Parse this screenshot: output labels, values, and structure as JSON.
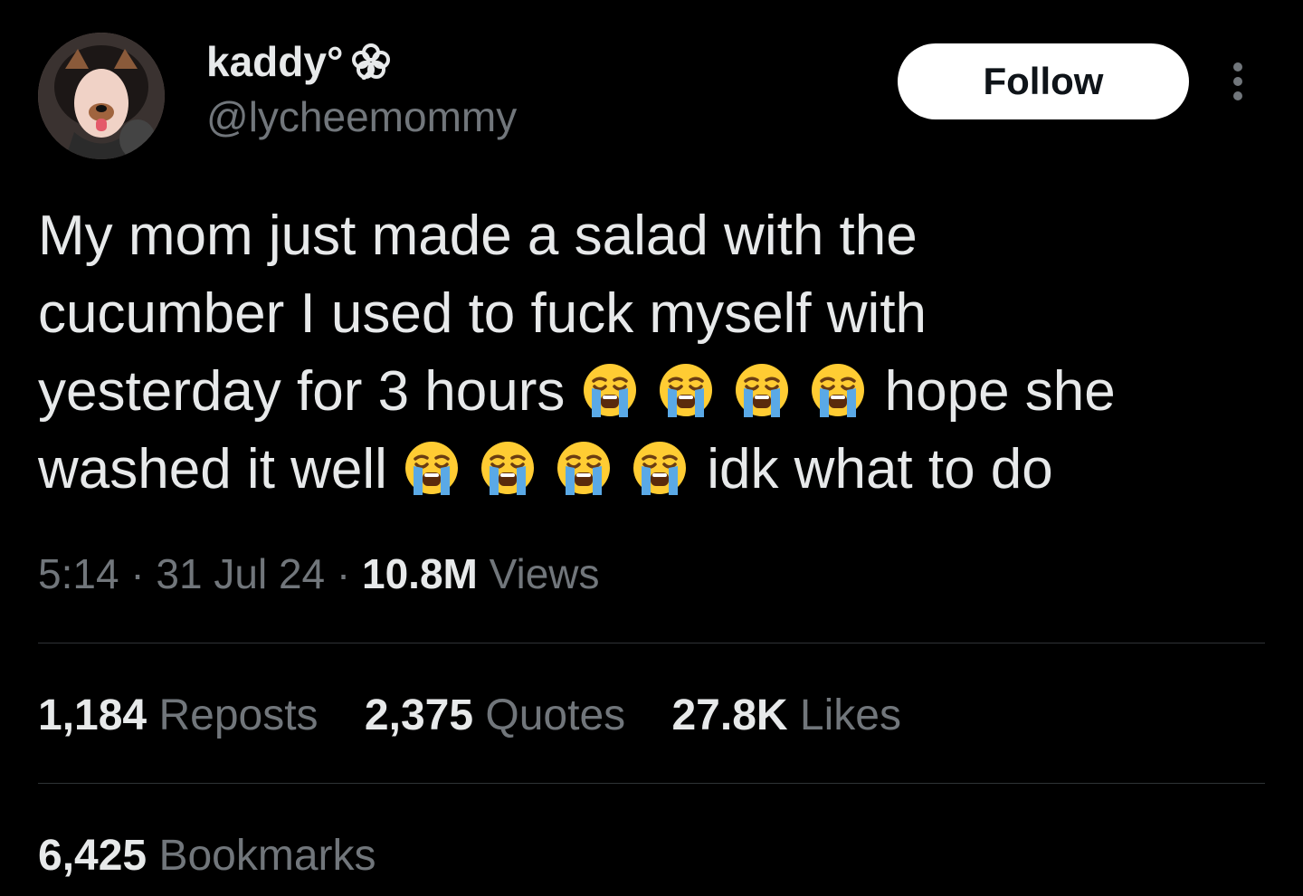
{
  "author": {
    "display_name": "kaddy°",
    "handle": "@lycheemommy",
    "avatar_icon": "avatar-photo",
    "name_decoration_icon": "flower-icon"
  },
  "follow_label": "Follow",
  "more_icon": "more-vertical-icon",
  "tweet": {
    "line1": "My mom just made a salad with the",
    "line2": "cucumber I used to fuck myself with",
    "line3_text": "yesterday for 3 hours",
    "line3_tail": "hope she",
    "line4_text": "washed it well",
    "line4_tail": "idk what to do",
    "emoji_name": "loudly-crying-face-emoji"
  },
  "meta": {
    "time": "5:14",
    "separator": "·",
    "date": "31 Jul 24",
    "views_count": "10.8M",
    "views_label": "Views"
  },
  "stats": {
    "reposts_count": "1,184",
    "reposts_label": "Reposts",
    "quotes_count": "2,375",
    "quotes_label": "Quotes",
    "likes_count": "27.8K",
    "likes_label": "Likes",
    "bookmarks_count": "6,425",
    "bookmarks_label": "Bookmarks"
  },
  "colors": {
    "background": "#000000",
    "primary_text": "#e7e9ea",
    "secondary_text": "#71767b",
    "divider": "#2f3336",
    "follow_bg": "#ffffff",
    "follow_text": "#0f1419",
    "emoji_face": "#ffcc33",
    "emoji_tears": "#5aa9e6"
  }
}
